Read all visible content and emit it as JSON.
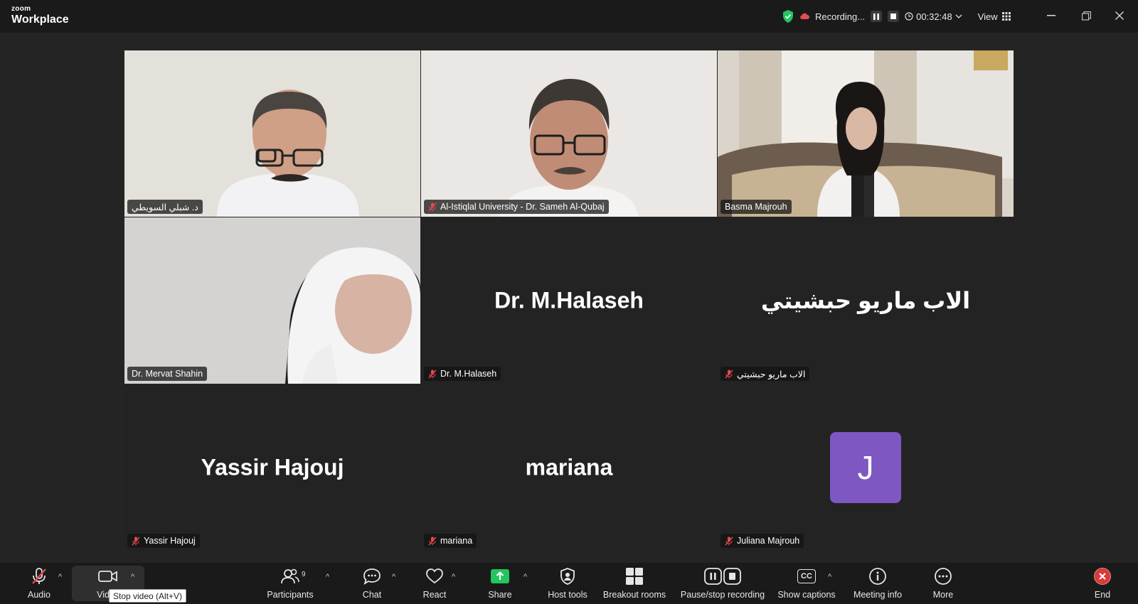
{
  "app": {
    "brand_small": "zoom",
    "brand_name": "Workplace"
  },
  "titlebar": {
    "recording_label": "Recording...",
    "elapsed": "00:32:48",
    "view_label": "View"
  },
  "participants": [
    {
      "name": "د. شبلي السويطي",
      "muted": false,
      "active_speaker": true,
      "video": true
    },
    {
      "name": "Al-Istiqlal University - Dr. Sameh Al-Qubaj",
      "muted": true,
      "video": true
    },
    {
      "name": "Basma Majrouh",
      "muted": false,
      "video": true
    },
    {
      "name": "Dr. Mervat Shahin",
      "muted": false,
      "video": true
    },
    {
      "name": "Dr. M.Halaseh",
      "display": "Dr. M.Halaseh",
      "muted": true,
      "video": false
    },
    {
      "name": "الاب ماريو حبشيتي",
      "display": "الاب ماريو حبشيتي",
      "muted": true,
      "video": false
    },
    {
      "name": "Yassir Hajouj",
      "display": "Yassir Hajouj",
      "muted": true,
      "video": false
    },
    {
      "name": "mariana",
      "display": "mariana",
      "muted": true,
      "video": false
    },
    {
      "name": "Juliana Majrouh",
      "avatar_letter": "J",
      "avatar_color": "#7e57c2",
      "muted": true,
      "video": false
    }
  ],
  "toolbar": {
    "audio": "Audio",
    "video": "Video",
    "participants": "Participants",
    "participants_count": "9",
    "chat": "Chat",
    "react": "React",
    "share": "Share",
    "host_tools": "Host tools",
    "breakout": "Breakout rooms",
    "record": "Pause/stop recording",
    "captions": "Show captions",
    "captions_icon": "CC",
    "meeting_info": "Meeting info",
    "more": "More",
    "end": "End",
    "tooltip": "Stop video (Alt+V)"
  },
  "colors": {
    "active_border": "#2ecc71",
    "share_green": "#22c55e",
    "end_red": "#d93a3a",
    "mute_red": "#e5484d"
  }
}
